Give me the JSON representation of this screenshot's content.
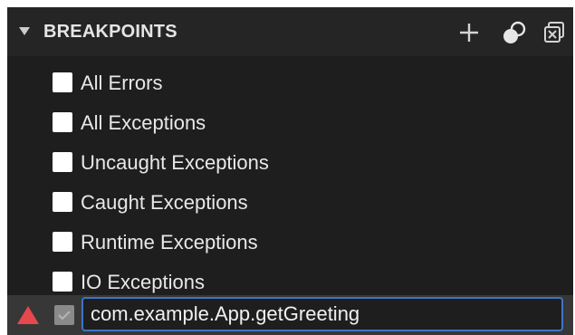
{
  "panel": {
    "title": "BREAKPOINTS",
    "toolbar": {
      "add_icon": "plus-icon",
      "toggle_icon": "toggle-activate-icon",
      "remove_icon": "close-all-icon"
    }
  },
  "breakpoints": [
    {
      "label": "All Errors",
      "checked": false
    },
    {
      "label": "All Exceptions",
      "checked": false
    },
    {
      "label": "Uncaught Exceptions",
      "checked": false
    },
    {
      "label": "Caught Exceptions",
      "checked": false
    },
    {
      "label": "Runtime Exceptions",
      "checked": false
    },
    {
      "label": "IO Exceptions",
      "checked": false
    }
  ],
  "edit_row": {
    "warning_icon": "warning-triangle-icon",
    "input_value": "com.example.App.getGreeting",
    "checked": true
  },
  "colors": {
    "background": "#1e1e1e",
    "header": "#252526",
    "focus_border": "#3e74c7",
    "warning": "#e5484d"
  }
}
